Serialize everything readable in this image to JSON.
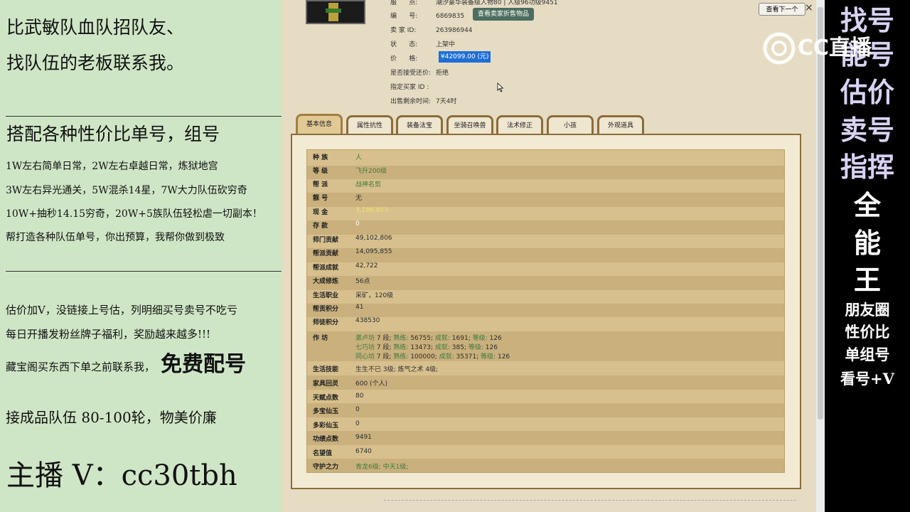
{
  "left": {
    "line1": "比武敏队血队招队友、",
    "line2": "找队伍的老板联系我。",
    "heading2": "搭配各种性价比单号，组号",
    "p1": "1W左右简单日常，2W左右卓越日常，炼狱地宫",
    "p2": "3W左右异光通关，5W混杀14星，7W大力队伍砍穷奇",
    "p3": "10W+抽秒14.15穷奇，20W+5族队伍轻松虐一切副本！",
    "p4": "帮打造各种队伍单号，你出预算，我帮你做到极致",
    "q1": "估价加V，没链接上号估，列明细买号卖号不吃亏",
    "q2": "每日开播发粉丝牌子福利，奖励越来越多!!!",
    "q3a": "藏宝阁买东西下单之前联系我，",
    "q3b": "免费配号",
    "q4": "接成品队伍 80-100轮，物美价廉",
    "anchor": "主播 V：cc30tbh"
  },
  "right": {
    "p1": "找号",
    "p2": "能号",
    "p3": "估价",
    "p4": "卖号",
    "p5": "指挥",
    "p6": "全",
    "p7": "能",
    "p8": "王",
    "w1": "朋友圈",
    "w2": "性价比",
    "w3": "单组号",
    "w4": "看号+V"
  },
  "logo": {
    "text": "CC直播"
  },
  "info": {
    "server_label": "服",
    "server_label2": "点:",
    "server_value": "潮汐豪华装备级人物80 | 人级96功级9451",
    "id_label": "编",
    "id_label2": "号:",
    "id_value": "6869835",
    "view_items_btn": "查看卖家折售物品",
    "seller_label": "卖  家  ID:",
    "seller_value": "263986944",
    "status_label": "状",
    "status_label2": "态:",
    "status_value": "上架中",
    "price_label": "价",
    "price_label2": "格:",
    "price_value": "¥42099.00 (元)",
    "bargain_label": "是否接受还价:",
    "bargain_value": "拒绝",
    "buyer_label": "指定买家 ID :",
    "buyer_value": "",
    "time_label": "出售剩余时间:",
    "time_value": "7天4时",
    "next_btn": "查看下一个",
    "close": "×"
  },
  "tabs": [
    "基本信息",
    "属性抗性",
    "装备法宝",
    "坐骑召唤兽",
    "法术修正",
    "小孩",
    "外观道具"
  ],
  "rows": [
    {
      "label": "种    族",
      "value": "人",
      "style": "g"
    },
    {
      "label": "等    级",
      "value": "飞升200级",
      "style": "g"
    },
    {
      "label": "帮    派",
      "value": "战神名剪",
      "style": "g"
    },
    {
      "label": "靓    号",
      "value": "无",
      "style": ""
    },
    {
      "label": "现    金",
      "value": "3,186,853",
      "style": "y"
    },
    {
      "label": "存    款",
      "value": "0",
      "style": "w"
    },
    {
      "label": "师门贡献",
      "value": "49,102,806",
      "style": ""
    },
    {
      "label": "帮派贡献",
      "value": "14,095,855",
      "style": ""
    },
    {
      "label": "帮派成就",
      "value": "42,722",
      "style": ""
    },
    {
      "label": "大成修炼",
      "value": "56点",
      "style": ""
    },
    {
      "label": "生活职业",
      "value": "采矿，120级",
      "style": ""
    },
    {
      "label": "帮贡积分",
      "value": "41",
      "style": ""
    },
    {
      "label": "师徒积分",
      "value": "438530",
      "style": ""
    },
    {
      "label": "生活技能",
      "value": "生生不已 3级; 炼气之术 4级;",
      "style": ""
    },
    {
      "label": "家具回灵",
      "value": "600 (个人)",
      "style": ""
    },
    {
      "label": "天赋点数",
      "value": "80",
      "style": ""
    },
    {
      "label": "多宝仙玉",
      "value": "0",
      "style": ""
    },
    {
      "label": "多彩仙玉",
      "value": "0",
      "style": ""
    },
    {
      "label": "功绩点数",
      "value": "9491",
      "style": ""
    },
    {
      "label": "名望值",
      "value": "6740",
      "style": ""
    },
    {
      "label": "守护之力",
      "value": "青龙6级; 中天1级;",
      "style": "g"
    }
  ],
  "workshop": {
    "label": "作    坊",
    "lines": [
      {
        "name": "漱卢坊",
        "lv": "7 段;",
        "k1": "熟练:",
        "v1": "56755",
        "k2": "成就:",
        "v2": "1691",
        "k3": "等级:",
        "v3": "126"
      },
      {
        "name": "七巧坊",
        "lv": "7 段;",
        "k1": "熟练:",
        "v1": "13473",
        "k2": "成就:",
        "v2": "385",
        "k3": "等级:",
        "v3": "126"
      },
      {
        "name": "同心坊",
        "lv": "7 段;",
        "k1": "熟练:",
        "v1": "100000",
        "k2": "成就:",
        "v2": "35371",
        "k3": "等级:",
        "v3": "126"
      }
    ]
  },
  "colors": {
    "left_bg": "#cfe6c6",
    "center_bg": "#e6dcc3",
    "table_bg": "#d7c08d",
    "price_bg": "#1e6fd6",
    "right_text": "#d9d2f2"
  }
}
